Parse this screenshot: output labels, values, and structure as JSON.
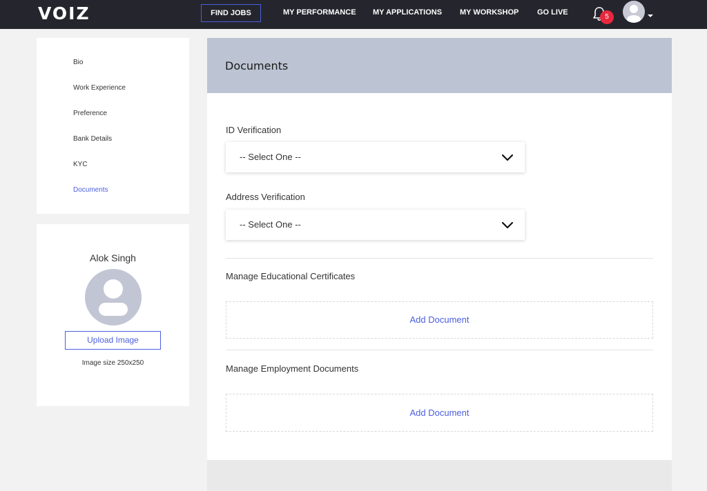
{
  "header": {
    "logo": "VOIZ",
    "nav": {
      "find_jobs": "FIND JOBS",
      "my_performance": "MY PERFORMANCE",
      "my_applications": "MY APPLICATIONS",
      "my_workshop": "MY WORKSHOP",
      "go_live": "GO LIVE"
    },
    "notification_count": "5",
    "icons": [
      "bell-icon",
      "user-avatar-icon",
      "caret-down-icon"
    ]
  },
  "sidebar": {
    "items": [
      {
        "label": "Bio"
      },
      {
        "label": "Work Experience"
      },
      {
        "label": "Preference"
      },
      {
        "label": "Bank Details"
      },
      {
        "label": "KYC"
      },
      {
        "label": "Documents",
        "active": true
      }
    ]
  },
  "profile": {
    "name": "Alok Singh",
    "upload_label": "Upload Image",
    "image_size": "Image size 250x250"
  },
  "main": {
    "title": "Documents",
    "id_verification": {
      "label": "ID Verification",
      "selected": "-- Select One --"
    },
    "address_verification": {
      "label": "Address Verification",
      "selected": "-- Select One --"
    },
    "educational": {
      "label": "Manage Educational Certificates",
      "add_label": "Add Document"
    },
    "employment": {
      "label": "Manage Employment Documents",
      "add_label": "Add Document"
    }
  },
  "colors": {
    "topbar": "#25252d",
    "accent": "#4a5ee0",
    "header_band": "#bcc3d2",
    "badge": "#e8283f",
    "page_bg": "#f2f2f2"
  }
}
